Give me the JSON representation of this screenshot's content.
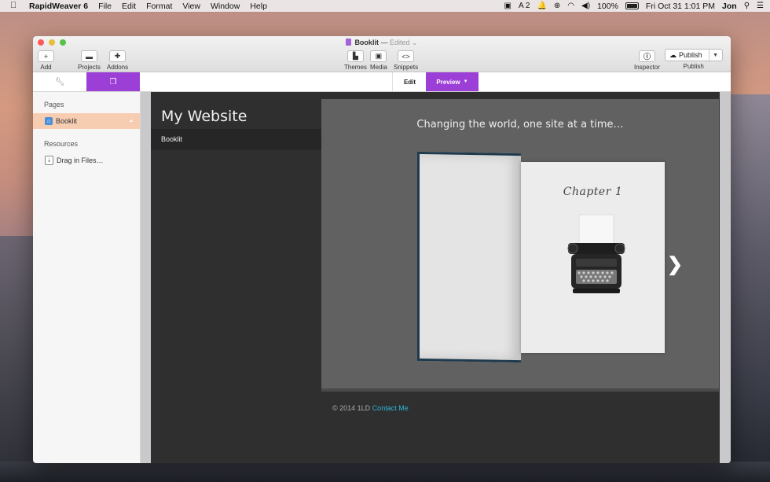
{
  "menubar": {
    "app_name": "RapidWeaver 6",
    "menus": [
      "File",
      "Edit",
      "Format",
      "View",
      "Window",
      "Help"
    ],
    "adobe_count": "2",
    "battery": "100%",
    "datetime": "Fri Oct 31  1:01 PM",
    "user": "Jon"
  },
  "window": {
    "document_title": "Booklit",
    "dash": "—",
    "edited_label": "Edited"
  },
  "toolbar": {
    "add_label": "Add",
    "projects_label": "Projects",
    "addons_label": "Addons",
    "themes_label": "Themes",
    "media_label": "Media",
    "snippets_label": "Snippets",
    "inspector_label": "Inspector",
    "publish_button": "Publish",
    "publish_label": "Publish"
  },
  "tabs": {
    "edit_label": "Edit",
    "preview_label": "Preview"
  },
  "sidebar": {
    "pages_header": "Pages",
    "pages": [
      {
        "label": "Booklit"
      }
    ],
    "resources_header": "Resources",
    "drag_files_label": "Drag in Files…"
  },
  "preview": {
    "site_title": "My Website",
    "nav_item": "Booklit",
    "tagline": "Changing the world, one site at a time…",
    "chapter_title": "Chapter 1",
    "footer_text": "© 2014 1LD",
    "footer_link": "Contact Me"
  },
  "colors": {
    "accent": "#9b3fd6",
    "selected_page": "#f7cdb1",
    "link": "#2fb3d9"
  }
}
